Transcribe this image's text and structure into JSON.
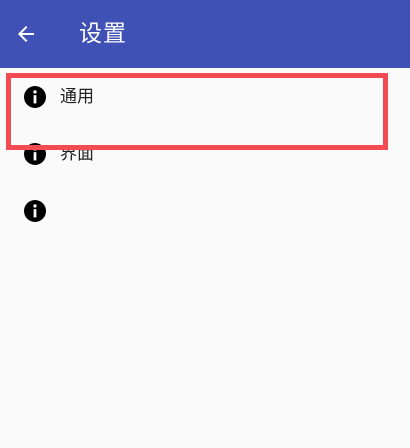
{
  "app_bar": {
    "title": "设置",
    "back_icon": "arrow-left-icon",
    "background": "#3f51b5"
  },
  "settings_list": {
    "items": [
      {
        "icon": "info-icon",
        "label": "通用"
      },
      {
        "icon": "info-icon",
        "label": "界面"
      },
      {
        "icon": "info-icon",
        "label": ""
      }
    ]
  },
  "highlight": {
    "color": "#f44a52",
    "target": "通用"
  }
}
